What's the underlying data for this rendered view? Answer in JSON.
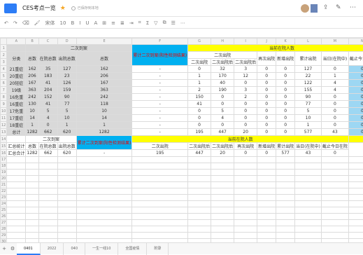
{
  "app": {
    "title": "CES考点一览",
    "save_status": "已保存到本地"
  },
  "toolbar": {
    "items": [
      "↶",
      "↷",
      "⌫",
      "🖌",
      "宋体",
      "10",
      "B",
      "I",
      "U",
      "A",
      "⊞",
      "≡",
      "≣",
      "⇥",
      "⌗",
      "Σ",
      "▽",
      "⧉",
      "☰",
      "⋯"
    ]
  },
  "columns": [
    "A",
    "B",
    "C",
    "D",
    "E",
    "F",
    "G",
    "H",
    "I",
    "J",
    "K",
    "L",
    "M",
    "N"
  ],
  "table1": {
    "header_title": "二次到案",
    "header_top": "累计出院后",
    "cat_label": "分类",
    "sub": [
      "总数",
      "在院总数",
      "出院总数",
      "总数"
    ],
    "red_label": "累计二次到案(阳性检测结果)",
    "f_label": "人数",
    "yellow_label": "当前在院人数",
    "h_group": "二次出院",
    "h_sub": [
      "二次出院",
      "二次出院后",
      "二次出院后"
    ],
    "k": "再次出院",
    "l": "新增出院",
    "m": "累计出院",
    "n": "当日(在院中)",
    "o": "截止今日在院",
    "rows": [
      {
        "cat": "21重症",
        "v": [
          "162",
          "35",
          "127",
          "162",
          "-",
          "0",
          "32",
          "3",
          "0",
          "0",
          "127",
          "0",
          "0"
        ]
      },
      {
        "cat": "20重症",
        "v": [
          "206",
          "183",
          "23",
          "206",
          "-",
          "1",
          "170",
          "12",
          "0",
          "0",
          "22",
          "1",
          "0"
        ]
      },
      {
        "cat": "20轻症",
        "v": [
          "167",
          "41",
          "126",
          "167",
          "-",
          "1",
          "40",
          "0",
          "0",
          "0",
          "122",
          "4",
          "0"
        ]
      },
      {
        "cat": "19级",
        "v": [
          "363",
          "204",
          "159",
          "363",
          "-",
          "2",
          "190",
          "3",
          "0",
          "0",
          "155",
          "4",
          "0"
        ]
      },
      {
        "cat": "16危重",
        "v": [
          "242",
          "152",
          "90",
          "242",
          "-",
          "150",
          "0",
          "2",
          "0",
          "0",
          "90",
          "0",
          "0"
        ]
      },
      {
        "cat": "16重症",
        "v": [
          "130",
          "41",
          "77",
          "118",
          "-",
          "41",
          "0",
          "0",
          "0",
          "0",
          "77",
          "0",
          "0"
        ]
      },
      {
        "cat": "17危重",
        "v": [
          "10",
          "5",
          "5",
          "10",
          "-",
          "0",
          "5",
          "0",
          "0",
          "0",
          "5",
          "0",
          "0"
        ]
      },
      {
        "cat": "17重症",
        "v": [
          "14",
          "4",
          "10",
          "14",
          "-",
          "0",
          "4",
          "0",
          "0",
          "0",
          "10",
          "0",
          "0"
        ]
      },
      {
        "cat": "18重症",
        "v": [
          "1",
          "0",
          "1",
          "1",
          "-",
          "0",
          "0",
          "0",
          "0",
          "0",
          "1",
          "0",
          "0"
        ]
      },
      {
        "cat": "总计",
        "v": [
          "1282",
          "662",
          "620",
          "1282",
          "-",
          "195",
          "447",
          "20",
          "0",
          "0",
          "577",
          "43",
          "0"
        ]
      }
    ]
  },
  "table2": {
    "title_a": "汇总统计",
    "header_title": "二次到案",
    "sub": [
      "总数",
      "在院总数",
      "出院总数"
    ],
    "red_label": "累计二次到案(阳性检测结果)",
    "f_label": "人数",
    "yellow_label": "当前在院人数",
    "h_sub": [
      "二次出院",
      "二次出院后",
      "二次出院后"
    ],
    "k": "再次出院",
    "l": "新增出院",
    "m": "累计出院",
    "n": "当日(在院中)",
    "o": "截止今日在院",
    "total_label": "汇总合计",
    "values": [
      "1282",
      "662",
      "620",
      "-",
      "195",
      "447",
      "20",
      "0",
      "0",
      "577",
      "43",
      "0"
    ]
  },
  "sheets": {
    "tabs": [
      "0401",
      "2022",
      "040",
      "一生一线10",
      "全国疫情",
      "附录"
    ],
    "active": 0
  }
}
